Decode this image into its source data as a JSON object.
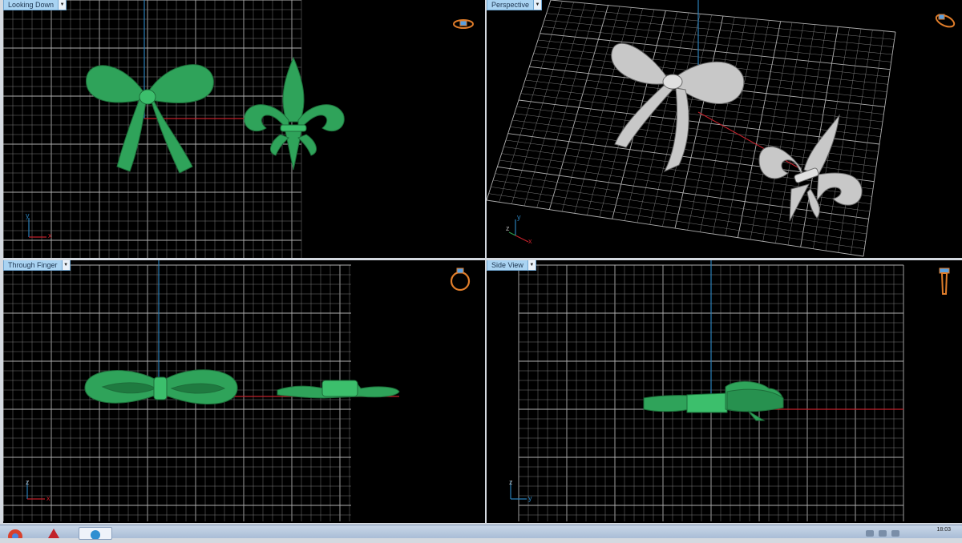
{
  "viewports": {
    "top_left": {
      "label": "Looking Down",
      "axis_a": "y",
      "axis_b": "x"
    },
    "top_right": {
      "label": "Perspective",
      "axis_a": "y",
      "axis_b": "x",
      "axis_c": "z"
    },
    "bottom_left": {
      "label": "Through Finger",
      "axis_a": "z",
      "axis_b": "x"
    },
    "bottom_right": {
      "label": "Side View",
      "axis_a": "z",
      "axis_b": "y"
    }
  },
  "colors": {
    "viewport_bg": "#000000",
    "grid": "#7a7a7a",
    "grid_major": "#b0b0b0",
    "axis_x": "#c0202a",
    "axis_y": "#2a7fb8",
    "model_green": "#2fa35a",
    "model_silver": "#c8c8c8",
    "label_bg": "#a9d3f2"
  },
  "taskbar": {
    "clock": "18:03"
  },
  "icons": {
    "view_ring_icon": "ring-icon",
    "taskbar_chrome": "chrome-icon",
    "taskbar_acrobat": "acrobat-icon",
    "taskbar_app": "app-icon"
  }
}
